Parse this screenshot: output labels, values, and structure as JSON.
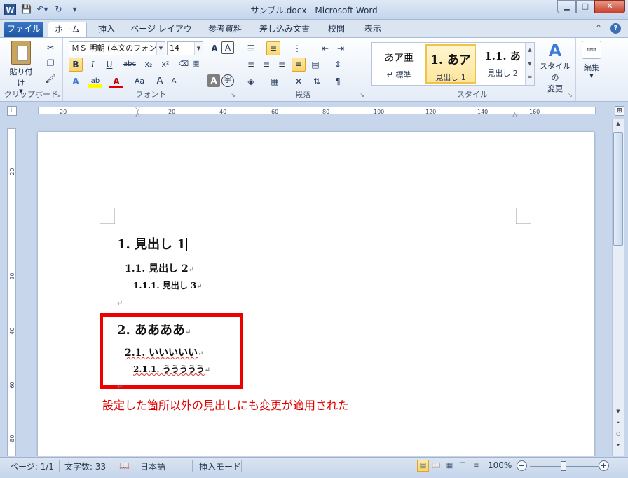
{
  "window": {
    "title": "サンプル.docx - Microsoft Word",
    "app_icon": "W"
  },
  "tabs": {
    "file": "ファイル",
    "items": [
      "ホーム",
      "挿入",
      "ページ レイアウト",
      "参考資料",
      "差し込み文書",
      "校閲",
      "表示"
    ],
    "active": "ホーム"
  },
  "ribbon": {
    "clipboard": {
      "paste_label": "貼り付け",
      "group_label": "クリップボード"
    },
    "font": {
      "font_name": "ＭＳ 明朝 (本文のフォン",
      "font_size": "14",
      "group_label": "フォント",
      "bold": "B",
      "italic": "I",
      "underline": "U",
      "strike": "abc",
      "subscript": "x₂",
      "superscript": "x²",
      "font_color": "A",
      "case": "Aa",
      "grow": "A",
      "shrink": "A",
      "ruby": "亜",
      "char_border": "A",
      "enclose": "字"
    },
    "paragraph": {
      "group_label": "段落"
    },
    "styles": {
      "group_label": "スタイル",
      "items": [
        {
          "preview": "あア亜",
          "name": "標準",
          "mark": "↵"
        },
        {
          "preview": "1.  あア",
          "name": "見出し 1"
        },
        {
          "preview": "1.1.  あ",
          "name": "見出し 2"
        }
      ],
      "change_label_1": "スタイルの",
      "change_label_2": "変更"
    },
    "editing": {
      "label": "編集"
    }
  },
  "ruler": {
    "ticks": [
      "20",
      "20",
      "40",
      "60",
      "80",
      "100",
      "120",
      "140",
      "160"
    ],
    "vticks": [
      "20",
      "20",
      "40",
      "60",
      "80"
    ]
  },
  "document": {
    "h1": "1. 見出し 1",
    "h2": "1.1. 見出し 2",
    "h3": "1.1.1. 見出し 3",
    "h1b": "2. ああああ",
    "h2b": "2.1. いいいいい",
    "h3b": "2.1.1. ううううう",
    "para_mark": "↵",
    "annotation": "設定した箇所以外の見出しにも変更が適用された",
    "colors": {
      "annotation": "#e00000",
      "box": "#ec0000"
    }
  },
  "status": {
    "page": "ページ: 1/1",
    "words": "文字数: 33",
    "language": "日本語",
    "mode": "挿入モード",
    "zoom": "100%"
  }
}
